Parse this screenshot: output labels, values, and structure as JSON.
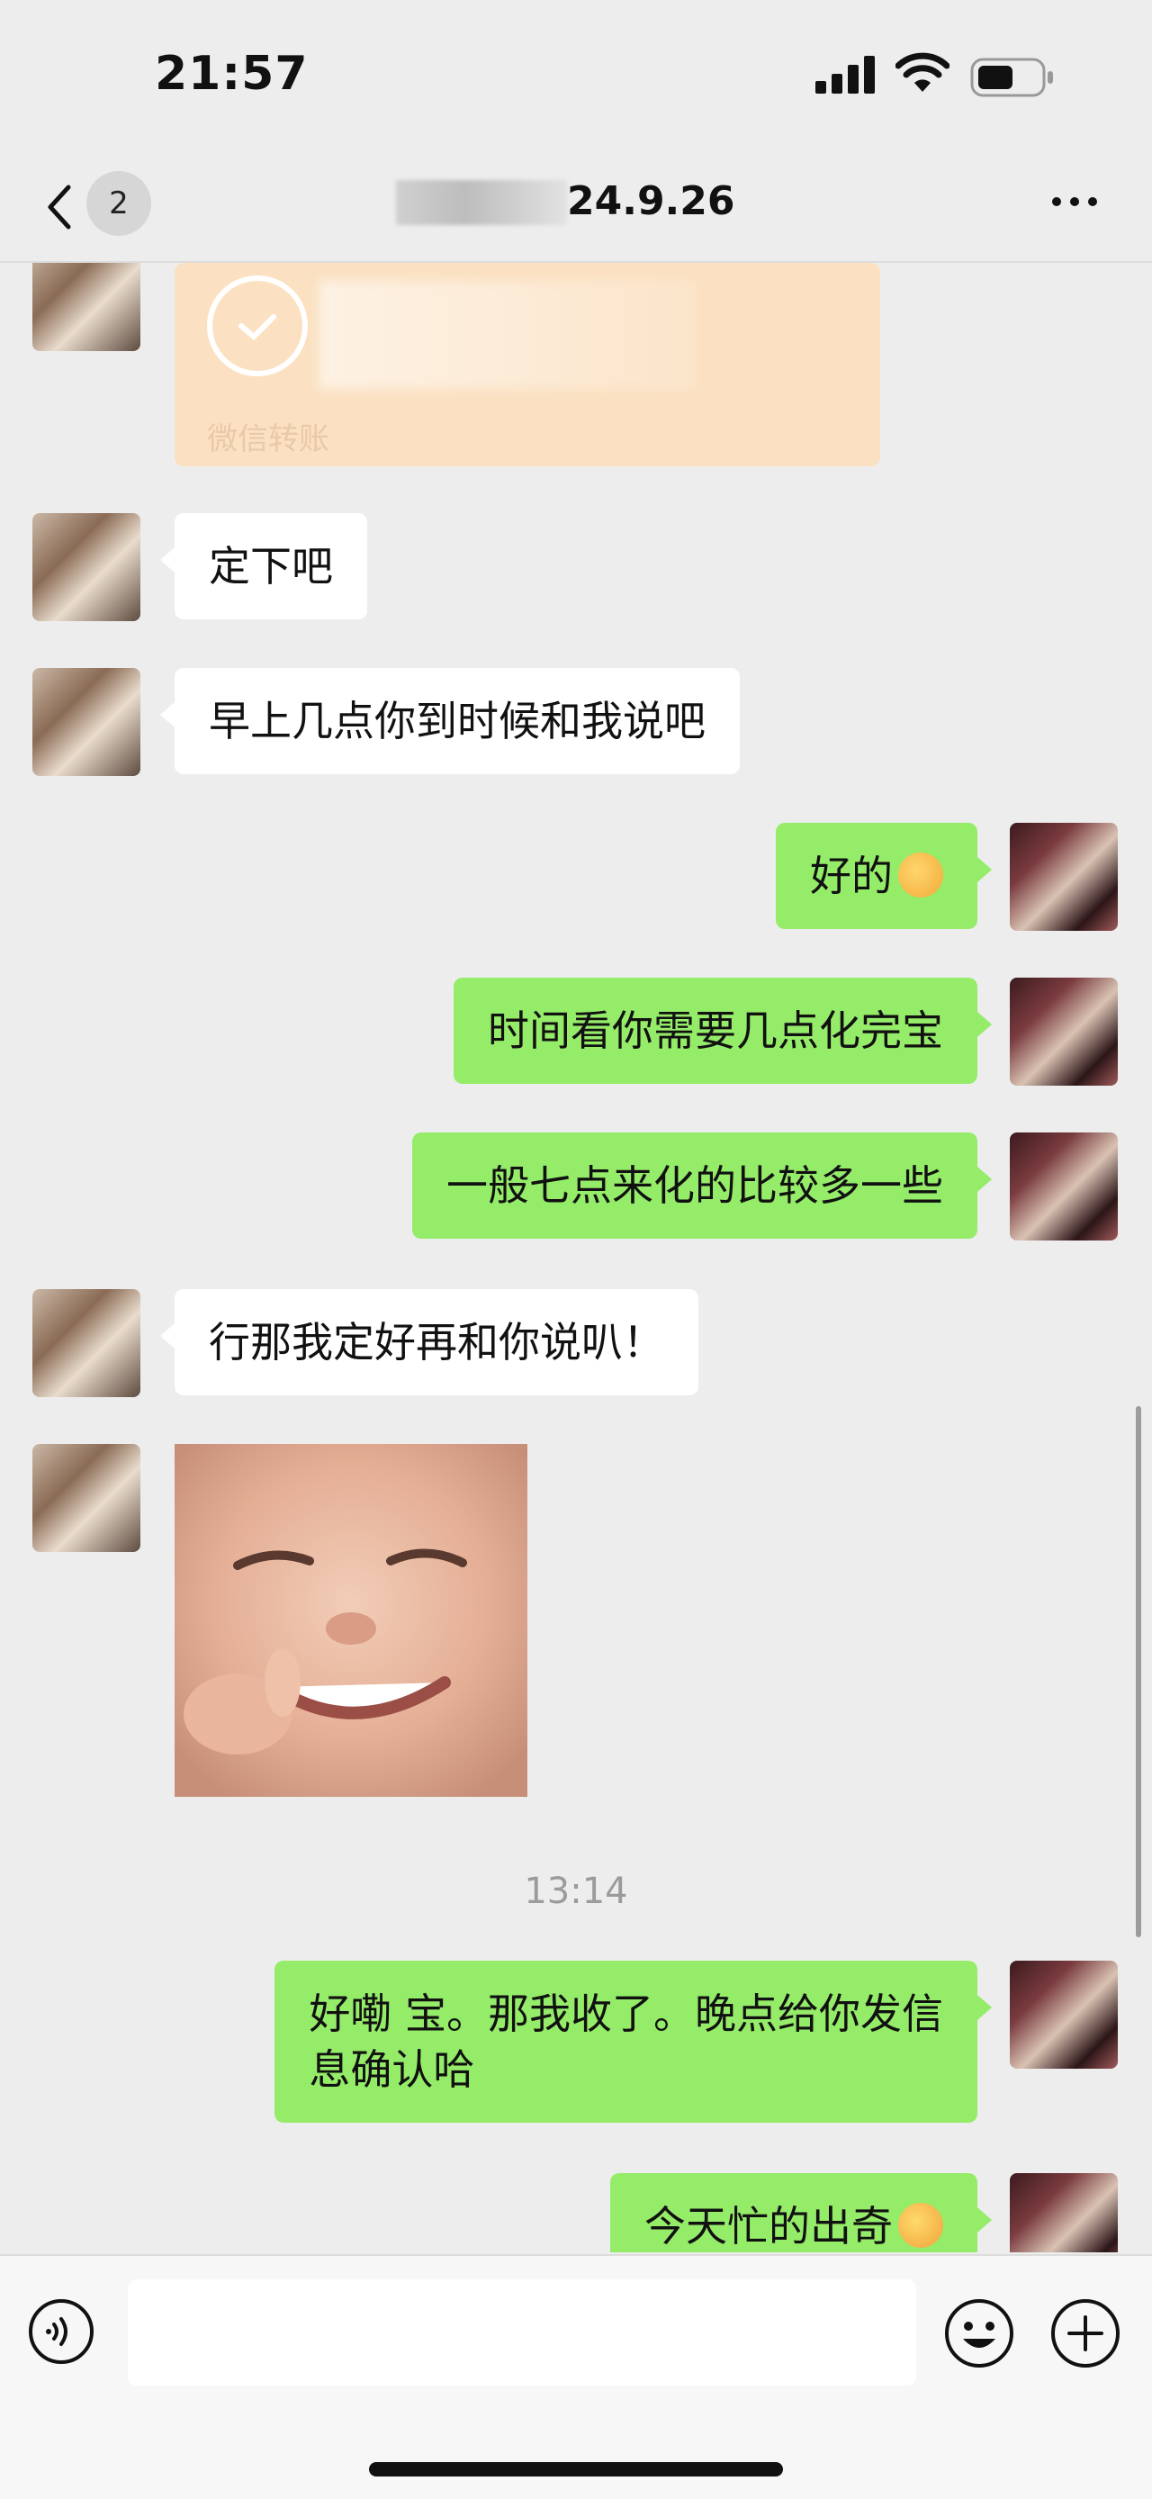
{
  "status_bar": {
    "time": "21:57"
  },
  "nav": {
    "unread_count": "2",
    "title_suffix": "24.9.26"
  },
  "messages": [
    {
      "side": "left",
      "type": "transfer",
      "label": "微信转账"
    },
    {
      "side": "left",
      "text": "定下吧"
    },
    {
      "side": "left",
      "text": "早上几点你到时候和我说吧"
    },
    {
      "side": "right",
      "text": "好的",
      "emoji": "ok-hand-emoji"
    },
    {
      "side": "right",
      "text": "时间看你需要几点化完宝"
    },
    {
      "side": "right",
      "text": "一般七点来化的比较多一些"
    },
    {
      "side": "left",
      "text": "行那我定好再和你说叭！"
    },
    {
      "side": "left",
      "type": "image",
      "image": "smiling-baby-sticker"
    },
    {
      "type": "timestamp",
      "text": "13:14"
    },
    {
      "side": "right",
      "text_line1": "好嘞 宝。那我收了。晚点给你发信",
      "text_line2": "息确认哈"
    },
    {
      "side": "right",
      "text": "今天忙的出奇",
      "emoji": "crying-laughing-emoji"
    }
  ],
  "input": {
    "value": "",
    "placeholder": ""
  },
  "colors": {
    "background": "#ededed",
    "bubble_out": "#95ec69",
    "bubble_in": "#ffffff",
    "transfer": "#fbe1c2"
  }
}
